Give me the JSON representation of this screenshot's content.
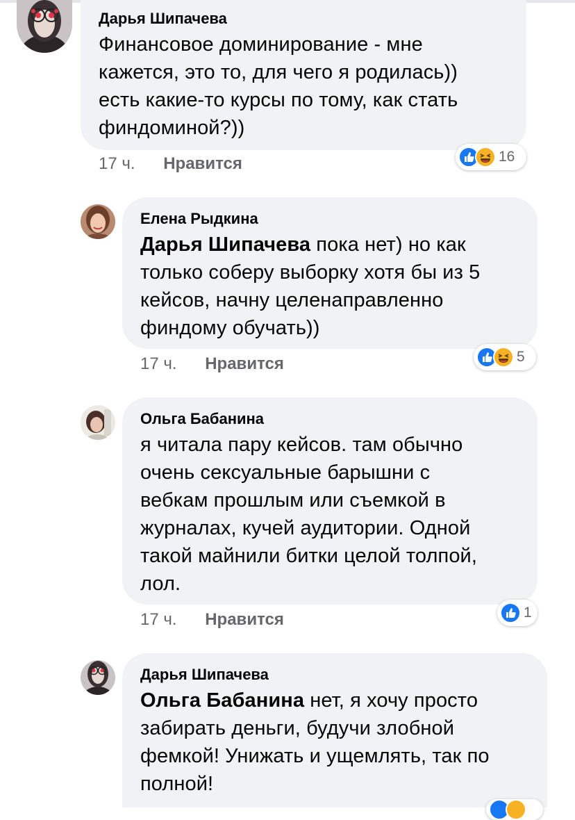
{
  "comments": [
    {
      "author": "Дарья Шипачева",
      "mention": "",
      "lines": [
        "Финансовое доминирование - мне",
        "кажется, это то, для чего я родилась))",
        "есть какие-то курсы по тому, как стать",
        "финдоминой?))"
      ],
      "time": "17 ч.",
      "like_label": "Нравится",
      "reaction_count": "16",
      "reactions": [
        "like-icon",
        "haha-icon"
      ]
    },
    {
      "author": "Елена Рыдкина",
      "mention": "Дарья Шипачева",
      "lines_first_rest": " пока нет) но как",
      "lines": [
        "только соберу выборку хотя бы из 5",
        "кейсов, начну целенаправленно",
        "финдому обучать))"
      ],
      "time": "17 ч.",
      "like_label": "Нравится",
      "reaction_count": "5",
      "reactions": [
        "like-icon",
        "haha-icon"
      ]
    },
    {
      "author": "Ольга Бабанина",
      "mention": "",
      "lines": [
        "я читала пару кейсов. там обычно",
        "очень сексуальные барышни с",
        "вебкам прошлым или съемкой в",
        "журналах, кучей аудитории. Одной",
        "такой майнили битки целой толпой,",
        "лол."
      ],
      "time": "17 ч.",
      "like_label": "Нравится",
      "reaction_count": "1",
      "reactions": [
        "like-icon"
      ]
    },
    {
      "author": "Дарья Шипачева",
      "mention": "Ольга Бабанина",
      "lines_first_rest": " нет, я хочу просто",
      "lines": [
        "забирать деньги, будучи злобной",
        "фемкой! Унижать и ущемлять, так по",
        "полной!"
      ],
      "time": "",
      "like_label": "",
      "reaction_count": "",
      "reactions": []
    }
  ],
  "colors": {
    "bubble": "#f0f2f5",
    "meta": "#65676b",
    "like_blue": "#1877f2",
    "haha_yellow": "#f7b125"
  }
}
